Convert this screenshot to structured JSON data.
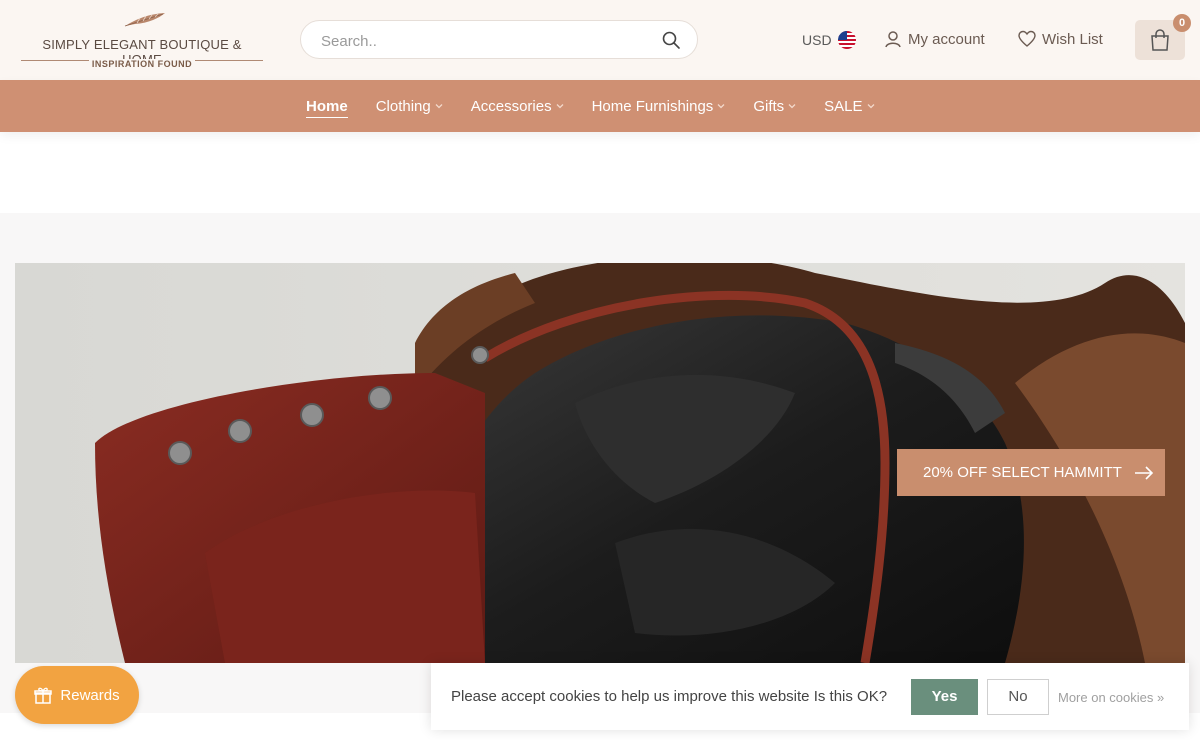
{
  "header": {
    "logo": {
      "line1": "SIMPLY ELEGANT BOUTIQUE & HOME",
      "line2": "INSPIRATION FOUND"
    },
    "search": {
      "placeholder": "Search.."
    },
    "currency": "USD",
    "account_label": "My account",
    "wishlist_label": "Wish List",
    "cart_count": "0"
  },
  "nav": {
    "items": [
      {
        "label": "Home",
        "active": true
      },
      {
        "label": "Clothing"
      },
      {
        "label": "Accessories"
      },
      {
        "label": "Home Furnishings"
      },
      {
        "label": "Gifts"
      },
      {
        "label": "SALE"
      }
    ]
  },
  "hero": {
    "promo_label": "20% OFF SELECT HAMMITT"
  },
  "rewards": {
    "label": "Rewards"
  },
  "cookie": {
    "message": "Please accept cookies to help us improve this website Is this OK?",
    "yes_label": "Yes",
    "no_label": "No",
    "more_label": "More on cookies »"
  },
  "colors": {
    "nav_bg": "#cf9073",
    "promo_bg": "#c98e6e",
    "rewards_bg": "#f2a341",
    "yes_bg": "#6a8f7d"
  }
}
